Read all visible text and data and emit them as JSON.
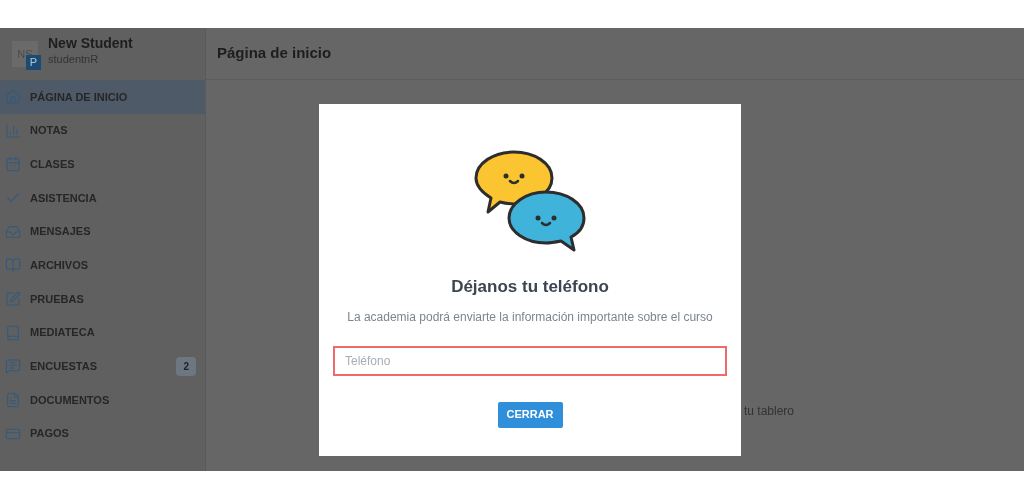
{
  "user": {
    "initials": "NS",
    "badge": "P",
    "name": "New Student",
    "username": "studentnR"
  },
  "header": {
    "title": "Página de inicio"
  },
  "sidebar": {
    "items": [
      {
        "kind": "home",
        "label": "PÁGINA DE INICIO",
        "selected": true
      },
      {
        "kind": "grades",
        "label": "NOTAS",
        "selected": false
      },
      {
        "kind": "classes",
        "label": "CLASES",
        "selected": false
      },
      {
        "kind": "attendance",
        "label": "ASISTENCIA",
        "selected": false
      },
      {
        "kind": "messages",
        "label": "MENSAJES",
        "selected": false
      },
      {
        "kind": "files",
        "label": "ARCHIVOS",
        "selected": false
      },
      {
        "kind": "tests",
        "label": "PRUEBAS",
        "selected": false
      },
      {
        "kind": "media",
        "label": "MEDIATECA",
        "selected": false
      },
      {
        "kind": "surveys",
        "label": "ENCUESTAS",
        "selected": false,
        "badge": "2"
      },
      {
        "kind": "documents",
        "label": "DOCUMENTOS",
        "selected": false
      },
      {
        "kind": "payments",
        "label": "PAGOS",
        "selected": false
      }
    ]
  },
  "main": {
    "text": "tu tablero"
  },
  "modal": {
    "title": "Déjanos tu teléfono",
    "text": "La academia podrá enviarte la información importante sobre el curso",
    "phone_field": {
      "placeholder": "Teléfono",
      "invalid": true
    },
    "button": "CERRAR"
  }
}
